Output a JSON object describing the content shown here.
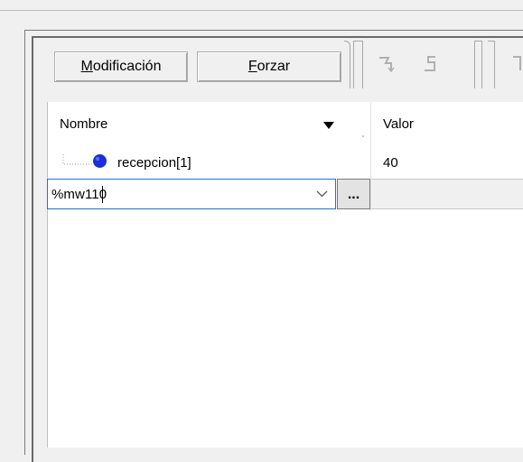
{
  "toolbar": {
    "modify_label": "Modificación",
    "modify_mnemonic": "M",
    "modify_rest": "odificación",
    "force_label": "Forzar",
    "force_mnemonic": "F",
    "force_rest": "orzar",
    "icons": [
      "step-over-icon",
      "step-into-icon"
    ]
  },
  "table": {
    "columns": [
      {
        "label": "Nombre",
        "sort_icon": "triangle-down-icon"
      },
      {
        "label": "Valor"
      }
    ],
    "rows": [
      {
        "icon": "blue-dot-icon",
        "name": "recepcion[1]",
        "value": "40"
      }
    ],
    "edit_row": {
      "input_value": "%mw110",
      "dropdown_icon": "chevron-down-icon",
      "browse_label": "..."
    }
  },
  "colors": {
    "accent": "#1f72d6",
    "dot": "#1a2fd6"
  }
}
